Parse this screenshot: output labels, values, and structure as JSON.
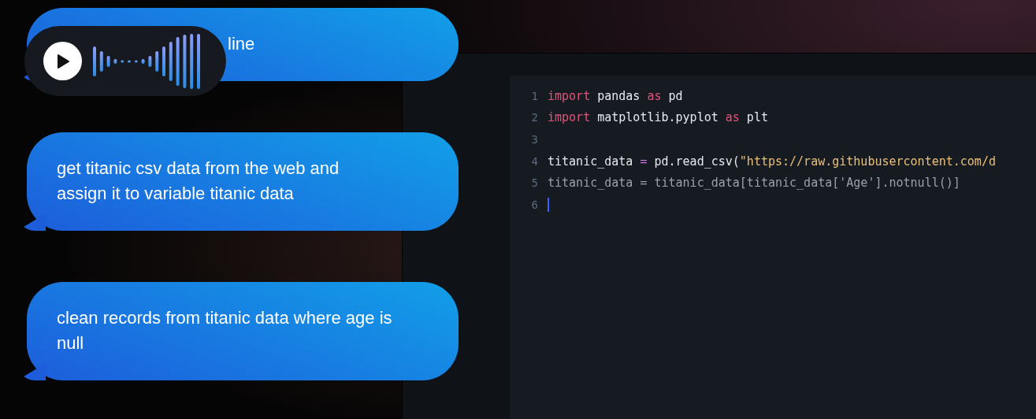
{
  "messages": [
    {
      "text": "line",
      "covered": true
    },
    {
      "text": "get titanic csv data from the web and assign it to variable titanic data",
      "covered": false
    },
    {
      "text": "clean records from titanic data where age is null",
      "covered": false
    }
  ],
  "voice_player": {
    "playing": false
  },
  "editor": {
    "lines": [
      {
        "number": "1",
        "cursor": false,
        "tokens": [
          {
            "kind": "keyword",
            "text": "import"
          },
          {
            "kind": "plain",
            "text": " pandas "
          },
          {
            "kind": "keyword",
            "text": "as"
          },
          {
            "kind": "plain",
            "text": " pd"
          }
        ]
      },
      {
        "number": "2",
        "cursor": false,
        "tokens": [
          {
            "kind": "keyword",
            "text": "import"
          },
          {
            "kind": "plain",
            "text": " matplotlib.pyplot "
          },
          {
            "kind": "keyword",
            "text": "as"
          },
          {
            "kind": "plain",
            "text": " plt"
          }
        ]
      },
      {
        "number": "3",
        "cursor": false
      },
      {
        "number": "4",
        "cursor": false,
        "tokens": [
          {
            "kind": "plain",
            "text": "titanic_data "
          },
          {
            "kind": "operator",
            "text": "="
          },
          {
            "kind": "plain",
            "text": " pd.read_csv("
          },
          {
            "kind": "string",
            "text": "\"https://raw.githubusercontent.com/d"
          }
        ]
      },
      {
        "number": "5",
        "cursor": false,
        "tokens": [
          {
            "kind": "muted",
            "text": "titanic_data = titanic_data[titanic_data['Age'].notnull()]"
          }
        ]
      },
      {
        "number": "6",
        "cursor": true
      }
    ]
  }
}
